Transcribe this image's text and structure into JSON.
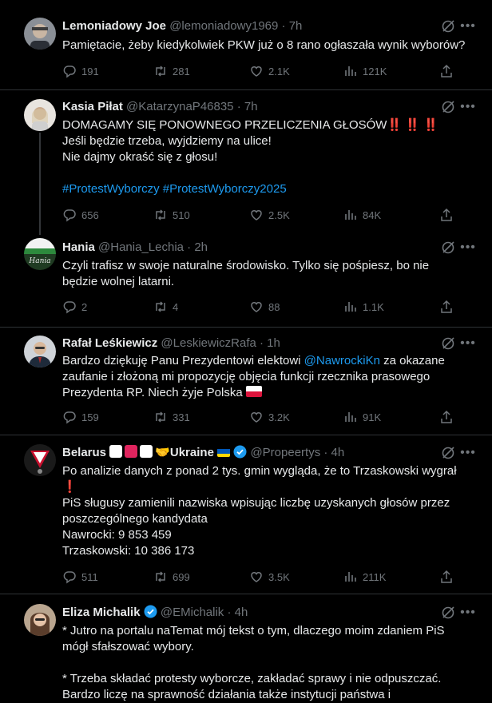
{
  "tweets": [
    {
      "name": "Lemoniadowy Joe",
      "handle": "@lemoniadowy1969",
      "time": "· 7h",
      "lines": [
        "Pamiętacie, żeby kiedykolwiek PKW już o 8 rano ogłaszała wynik wyborów?"
      ],
      "replies": "191",
      "reposts": "281",
      "likes": "2.1K",
      "views": "121K"
    },
    {
      "name": "Kasia Piłat",
      "handle": "@KatarzynaP46835",
      "time": "· 7h",
      "lines": [
        "DOMAGAMY SIĘ PONOWNEGO PRZELICZENIA GŁOSÓW",
        "Jeśli będzie trzeba, wyjdziemy na ulice!",
        "Nie dajmy okraść się z głosu!"
      ],
      "emphasis": "‼️ ‼️ ‼️",
      "hashtags": "#ProtestWyborczy #ProtestWyborczy2025",
      "replies": "656",
      "reposts": "510",
      "likes": "2.5K",
      "views": "84K"
    },
    {
      "name": "Hania",
      "handle": "@Hania_Lechia",
      "time": "· 2h",
      "lines": [
        "Czyli trafisz w swoje naturalne środowisko. Tylko się pośpiesz, bo nie",
        "będzie wolnej latarni."
      ],
      "avatar_text": "Hania",
      "replies": "2",
      "reposts": "4",
      "likes": "88",
      "views": "1.1K"
    },
    {
      "name": "Rafał Leśkiewicz",
      "handle": "@LeskiewiczRafa",
      "time": "· 1h",
      "line1_pre": "Bardzo dziękuję Panu Prezydentowi elektowi ",
      "mention": "@NawrockiKn",
      "line1_post": " za okazane",
      "lines": [
        "zaufanie i złożoną mi propozycję objęcia funkcji rzecznika prasowego",
        "Prezydenta RP. Niech żyje Polska"
      ],
      "replies": "159",
      "reposts": "331",
      "likes": "3.2K",
      "views": "91K"
    },
    {
      "name": "Belarus",
      "name_suffix": "🤝Ukraine",
      "handle": "@Propeertys",
      "time": "· 4h",
      "lines": [
        "Po analizie danych z ponad 2 tys. gmin wygląda, że to Trzaskowski wygrał",
        "❗",
        "PiS sługusy zamienili nazwiska wpisując liczbę uzyskanych głosów przez",
        "poszczególnego kandydata",
        "Nawrocki: 9 853 459",
        "Trzaskowski: 10 386 173"
      ],
      "replies": "511",
      "reposts": "699",
      "likes": "3.5K",
      "views": "211K"
    },
    {
      "name": "Eliza Michalik",
      "handle": "@EMichalik",
      "time": "· 4h",
      "lines": [
        "* Jutro na portalu naTemat mój tekst o tym, dlaczego moim zdaniem PiS",
        "mógł sfałszować wybory.",
        "",
        "* Trzeba składać protesty wyborcze, zakładać sprawy i nie odpuszczać.",
        "Bardzo liczę na sprawność działania także instytucji państwa i"
      ]
    }
  ],
  "colors": {
    "accent": "#1d9bf0",
    "muted": "#71767b",
    "text": "#e7e9ea",
    "border": "#2f3336",
    "bg": "#000000"
  }
}
